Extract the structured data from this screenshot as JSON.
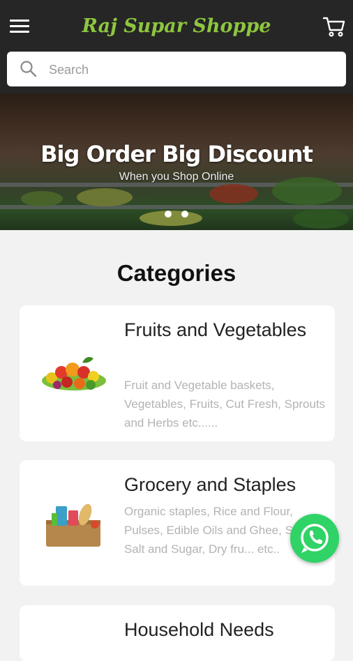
{
  "header": {
    "app_title": "Raj Supar Shoppe",
    "menu_icon": "hamburger-menu-icon",
    "cart_icon": "shopping-cart-icon",
    "brand_color": "#8dc63f",
    "bar_color": "#262626"
  },
  "search": {
    "placeholder": "Search",
    "value": "",
    "icon": "search-icon"
  },
  "banner": {
    "headline": "Big Order Big Discount",
    "subtext": "When you Shop Online",
    "slide_count": 2
  },
  "categories_title": "Categories",
  "categories": [
    {
      "name": "Fruits and Vegetables",
      "description": "Fruit and Vegetable baskets, Vegetables, Fruits, Cut Fresh, Sprouts and Herbs etc......",
      "icon": "fruits-vegetables-image"
    },
    {
      "name": "Grocery and Staples",
      "description": "Organic staples, Rice and Flour, Pulses, Edible Oils and Ghee, Spices, Salt and Sugar, Dry fru... etc..",
      "icon": "grocery-bag-image"
    },
    {
      "name": "Household Needs",
      "description": "",
      "icon": "household-image"
    }
  ],
  "floating_action": {
    "icon": "whatsapp-icon",
    "color": "#2fd366"
  }
}
